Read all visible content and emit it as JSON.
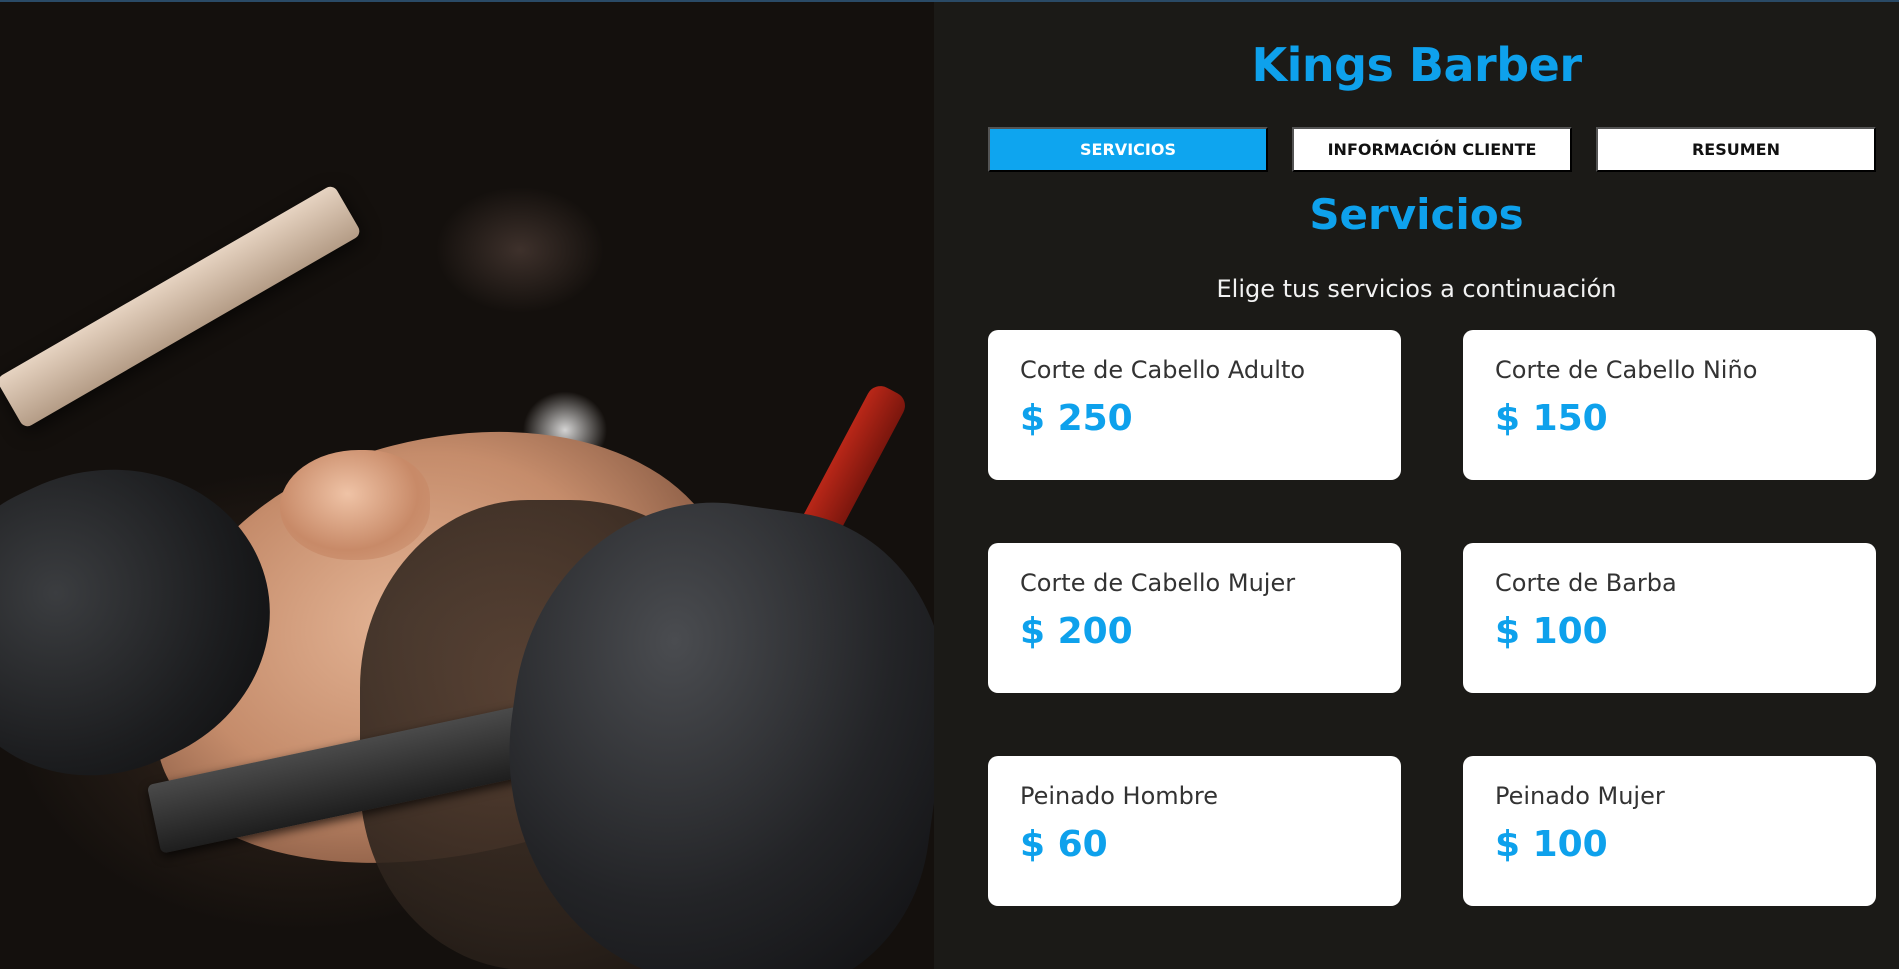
{
  "brand": {
    "title": "Kings Barber"
  },
  "tabs": [
    {
      "label": "SERVICIOS",
      "active": true
    },
    {
      "label": "INFORMACIÓN CLIENTE",
      "active": false
    },
    {
      "label": "RESUMEN",
      "active": false
    }
  ],
  "section": {
    "title": "Servicios",
    "subtitle": "Elige tus servicios a continuación"
  },
  "services": [
    {
      "name": "Corte de Cabello Adulto",
      "price": "$ 250"
    },
    {
      "name": "Corte de Cabello Niño",
      "price": "$ 150"
    },
    {
      "name": "Corte de Cabello Mujer",
      "price": "$ 200"
    },
    {
      "name": "Corte de Barba",
      "price": "$ 100"
    },
    {
      "name": "Peinado Hombre",
      "price": "$ 60"
    },
    {
      "name": "Peinado Mujer",
      "price": "$ 100"
    }
  ],
  "colors": {
    "accent": "#0ea1ec",
    "panel_background": "#1b1a17",
    "card_background": "#ffffff"
  }
}
